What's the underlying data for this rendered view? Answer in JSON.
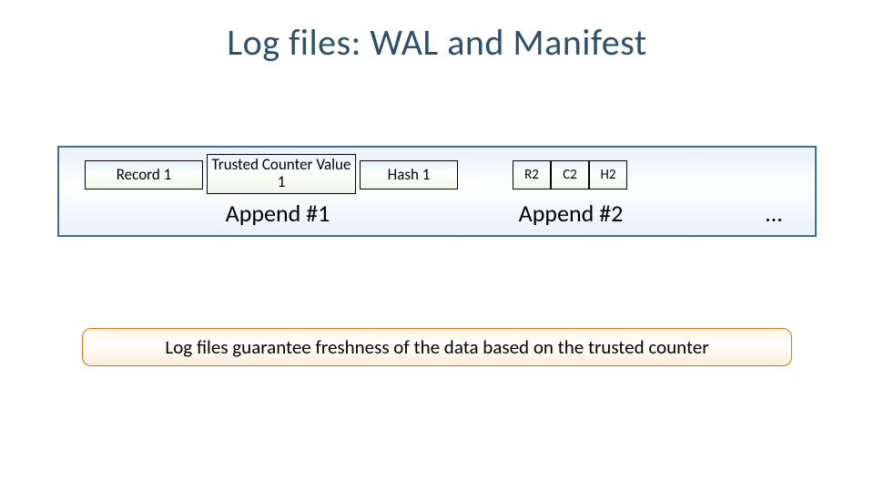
{
  "title": "Log files: WAL and Manifest",
  "append1": {
    "record": "Record 1",
    "counter": "Trusted Counter Value 1",
    "hash": "Hash 1",
    "label": "Append #1"
  },
  "append2": {
    "r": "R2",
    "c": "C2",
    "h": "H2",
    "label": "Append #2"
  },
  "ellipsis": "…",
  "callout": "Log files guarantee freshness of the data based on the trusted counter"
}
